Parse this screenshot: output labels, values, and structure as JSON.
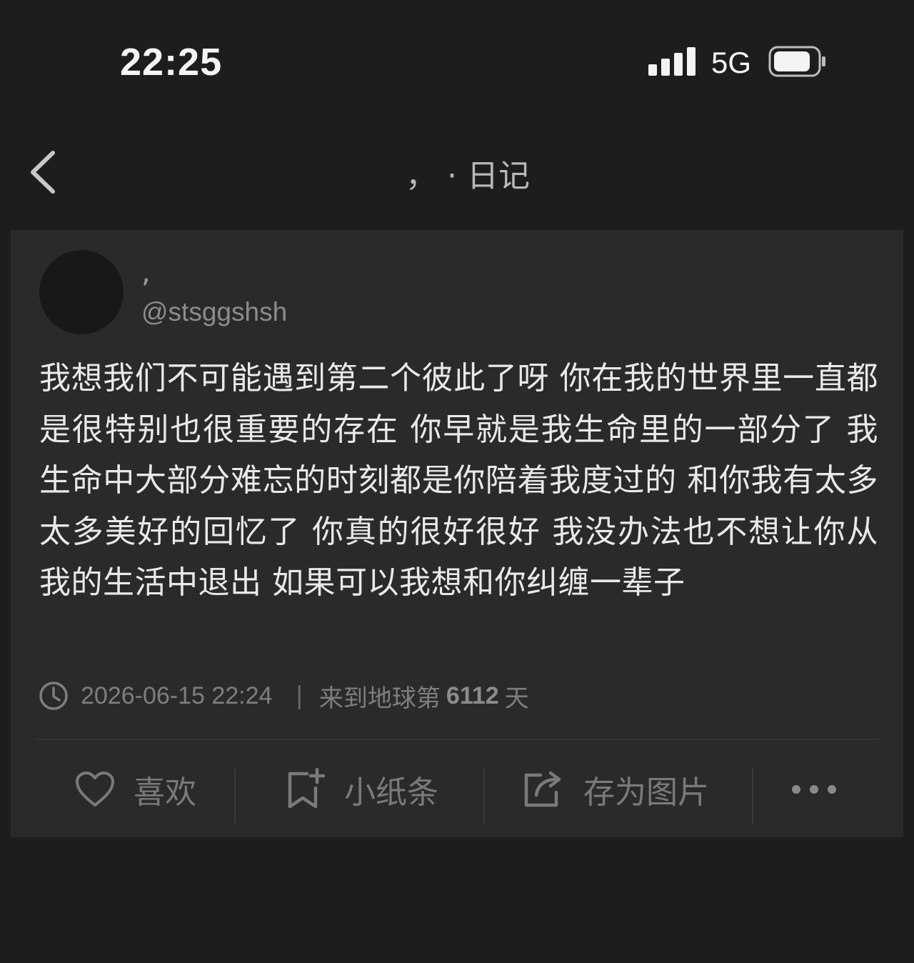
{
  "status_bar": {
    "time": "22:25",
    "network": "5G"
  },
  "nav": {
    "title": "，   · 日记"
  },
  "post": {
    "author_name": ",",
    "author_handle": "@stsggshsh",
    "body": "我想我们不可能遇到第二个彼此了呀 你在我的世界里一直都是很特别也很重要的存在 你早就是我生命里的一部分了 我生命中大部分难忘的时刻都是你陪着我度过的 和你我有太多太多美好的回忆了 你真的很好很好 我没办法也不想让你从我的生活中退出 如果可以我想和你纠缠一辈子",
    "timestamp": "2026-06-15 22:24",
    "separator": "|",
    "days_prefix": "来到地球第",
    "days_count": "6112",
    "days_suffix": "天"
  },
  "actions": {
    "like_label": "喜欢",
    "note_label": "小纸条",
    "save_image_label": "存为图片"
  },
  "icons": {
    "back": "chevron-left-icon",
    "clock": "clock-icon",
    "like": "heart-icon",
    "note": "bookmark-plus-icon",
    "save_image": "share-icon",
    "more": "more-dots-icon"
  },
  "colors": {
    "background": "#1d1d1d",
    "card": "#2a2a2a",
    "text_primary": "#e9e9e9",
    "text_muted": "#7a7a7a"
  }
}
